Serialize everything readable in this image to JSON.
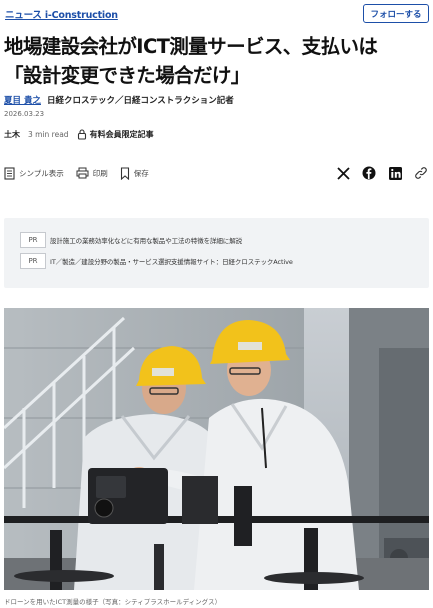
{
  "header": {
    "category_link": "ニュース i-Construction",
    "follow_label": "フォローする"
  },
  "article": {
    "title_line1": "地場建設会社がICT測量サービス、支払いは",
    "title_line2": "「設計変更できた場合だけ」",
    "author": "夏目 貴之",
    "author_affiliation": "日経クロステック／日経コンストラクション記者",
    "date": "2026.03.23",
    "tag": "土木",
    "read_time": "3 min read",
    "member_label": "有料会員限定記事"
  },
  "toolbar": {
    "simple_view": "シンプル表示",
    "print": "印刷",
    "save": "保存",
    "share_icons": [
      "x-icon",
      "facebook-icon",
      "linkedin-icon",
      "link-icon"
    ]
  },
  "pr": {
    "items": [
      {
        "badge": "PR",
        "text": "設計施工の業務効率化などに有用な製品や工法の特徴を詳細に解説"
      },
      {
        "badge": "PR",
        "text": "IT／製造／建設分野の製品・サービス選択支援情報サイト：日経クロステックActive"
      }
    ]
  },
  "photo": {
    "caption": "ドローンを用いたICT測量の様子（写真：シティプラスホールディングス）"
  },
  "colors": {
    "link_blue": "#1d4fa8",
    "pr_bg": "#f1f3f5",
    "helmet_yellow": "#f2c21b"
  }
}
